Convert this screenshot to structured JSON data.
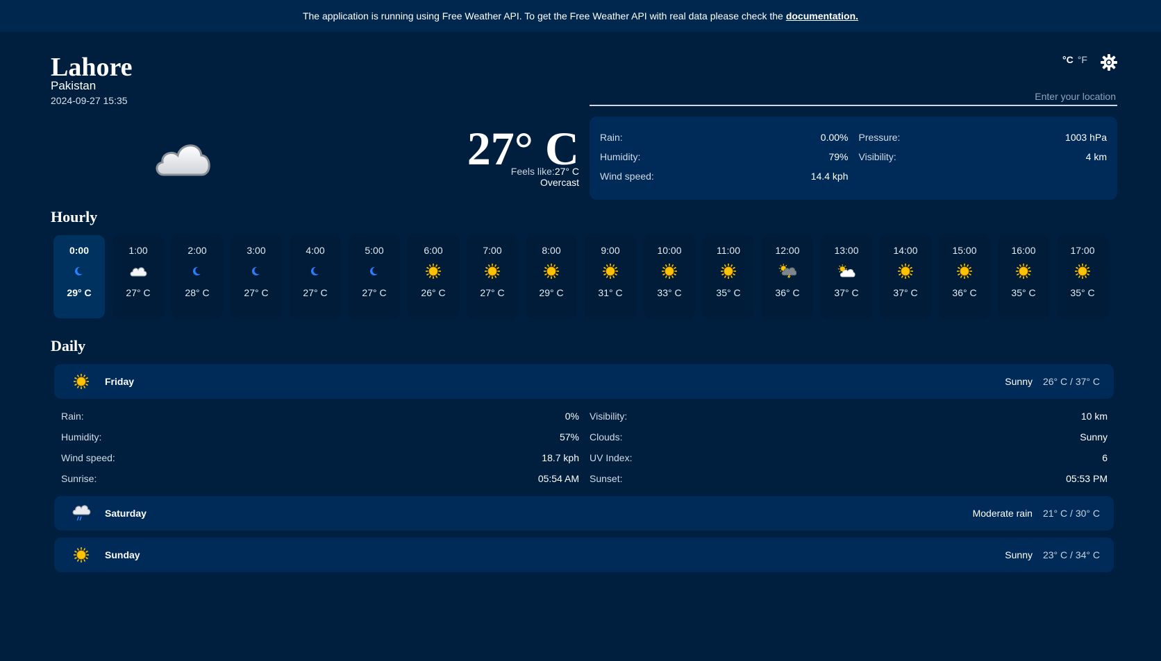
{
  "banner": {
    "text": "The application is running using Free Weather API. To get the Free Weather API with real data please check the",
    "link": "documentation."
  },
  "location": {
    "city": "Lahore",
    "country": "Pakistan",
    "datetime": "2024-09-27 15:35"
  },
  "units": {
    "celsius": "°C",
    "fahrenheit": "°F",
    "selected": "celsius"
  },
  "search": {
    "placeholder": "Enter your location",
    "value": ""
  },
  "current": {
    "icon": "cloud-icon",
    "temperature": "27° C",
    "feels_label": "Feels like:",
    "feels_value": "27° C",
    "condition": "Overcast"
  },
  "stats": [
    {
      "label": "Rain:",
      "value": "0.00%"
    },
    {
      "label": "Pressure:",
      "value": "1003 hPa"
    },
    {
      "label": "Humidity:",
      "value": "79%"
    },
    {
      "label": "Visibility:",
      "value": "4 km"
    },
    {
      "label": "Wind speed:",
      "value": "14.4 kph"
    }
  ],
  "hourly_title": "Hourly",
  "hourly": [
    {
      "time": "0:00",
      "icon": "moon",
      "temp": "29° C",
      "active": true
    },
    {
      "time": "1:00",
      "icon": "cloud",
      "temp": "27° C"
    },
    {
      "time": "2:00",
      "icon": "moon",
      "temp": "28° C"
    },
    {
      "time": "3:00",
      "icon": "moon",
      "temp": "27° C"
    },
    {
      "time": "4:00",
      "icon": "moon",
      "temp": "27° C"
    },
    {
      "time": "5:00",
      "icon": "moon",
      "temp": "27° C"
    },
    {
      "time": "6:00",
      "icon": "sun",
      "temp": "26° C"
    },
    {
      "time": "7:00",
      "icon": "sun",
      "temp": "27° C"
    },
    {
      "time": "8:00",
      "icon": "sun",
      "temp": "29° C"
    },
    {
      "time": "9:00",
      "icon": "sun",
      "temp": "31° C"
    },
    {
      "time": "10:00",
      "icon": "sun",
      "temp": "33° C"
    },
    {
      "time": "11:00",
      "icon": "sun",
      "temp": "35° C"
    },
    {
      "time": "12:00",
      "icon": "thunder",
      "temp": "36° C"
    },
    {
      "time": "13:00",
      "icon": "partly-cloudy",
      "temp": "37° C"
    },
    {
      "time": "14:00",
      "icon": "sun",
      "temp": "37° C"
    },
    {
      "time": "15:00",
      "icon": "sun",
      "temp": "36° C"
    },
    {
      "time": "16:00",
      "icon": "sun",
      "temp": "35° C"
    },
    {
      "time": "17:00",
      "icon": "sun",
      "temp": "35° C"
    }
  ],
  "daily_title": "Daily",
  "daily": [
    {
      "icon": "sun",
      "day": "Friday",
      "condition": "Sunny",
      "range": "26° C / 37° C",
      "expanded": true
    },
    {
      "icon": "rain",
      "day": "Saturday",
      "condition": "Moderate rain",
      "range": "21° C / 30° C"
    },
    {
      "icon": "sun",
      "day": "Sunday",
      "condition": "Sunny",
      "range": "23° C / 34° C"
    }
  ],
  "day_details": [
    {
      "label": "Rain:",
      "value": "0%"
    },
    {
      "label": "Visibility:",
      "value": "10 km"
    },
    {
      "label": "Humidity:",
      "value": "57%"
    },
    {
      "label": "Clouds:",
      "value": "Sunny"
    },
    {
      "label": "Wind speed:",
      "value": "18.7 kph"
    },
    {
      "label": "UV Index:",
      "value": "6"
    },
    {
      "label": "Sunrise:",
      "value": "05:54 AM"
    },
    {
      "label": "Sunset:",
      "value": "05:53 PM"
    }
  ],
  "colors": {
    "background": "#001e3d",
    "banner": "#00284f",
    "card": "#002a57",
    "sun": "#ffc400",
    "moon": "#2a7fff"
  }
}
